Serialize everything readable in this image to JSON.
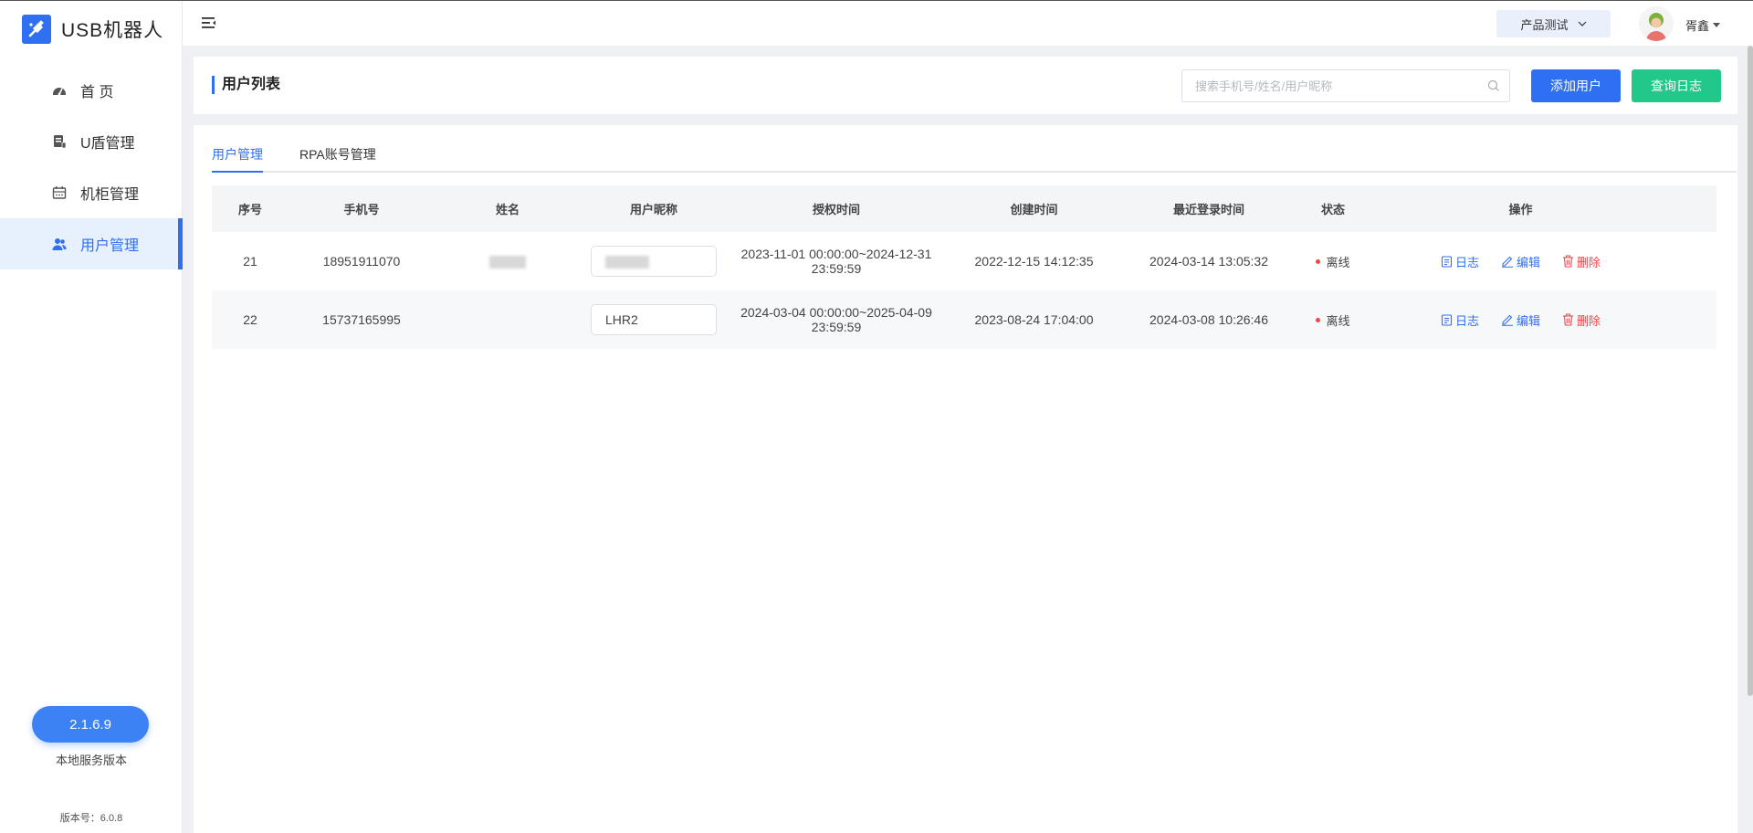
{
  "app": {
    "title": "USB机器人",
    "brand_color": "#2f6ff1"
  },
  "sidebar": {
    "items": [
      {
        "label": "首 页",
        "icon": "dashboard-icon",
        "active": false
      },
      {
        "label": "U盾管理",
        "icon": "ukey-icon",
        "active": false
      },
      {
        "label": "机柜管理",
        "icon": "cabinet-icon",
        "active": false
      },
      {
        "label": "用户管理",
        "icon": "users-icon",
        "active": true
      }
    ],
    "version_badge": "2.1.6.9",
    "version_caption": "本地服务版本",
    "version_number": "版本号：6.0.8"
  },
  "header": {
    "project_select": "产品测试",
    "user_name": "胥鑫"
  },
  "page": {
    "title": "用户列表",
    "search_placeholder": "搜索手机号/姓名/用户昵称",
    "add_user_label": "添加用户",
    "query_log_label": "查询日志"
  },
  "tabs": [
    {
      "label": "用户管理",
      "active": true
    },
    {
      "label": "RPA账号管理",
      "active": false
    }
  ],
  "table": {
    "columns": [
      "序号",
      "手机号",
      "姓名",
      "用户昵称",
      "授权时间",
      "创建时间",
      "最近登录时间",
      "状态",
      "操作"
    ],
    "rows": [
      {
        "index": "21",
        "phone": "18951911070",
        "name": "",
        "nickname": "",
        "auth_time": "2023-11-01 00:00:00~2024-12-31 23:59:59",
        "created": "2022-12-15 14:12:35",
        "last_login": "2024-03-14 13:05:32",
        "status": "离线"
      },
      {
        "index": "22",
        "phone": "15737165995",
        "name": "",
        "nickname": "LHR2",
        "auth_time": "2024-03-04 00:00:00~2025-04-09 23:59:59",
        "created": "2023-08-24 17:04:00",
        "last_login": "2024-03-08 10:26:46",
        "status": "离线"
      }
    ],
    "actions": {
      "log": "日志",
      "edit": "编辑",
      "delete": "删除"
    }
  },
  "colors": {
    "primary": "#2f6ff1",
    "success": "#22c88a",
    "danger": "#f0464a",
    "status_offline": "#f0464a"
  }
}
